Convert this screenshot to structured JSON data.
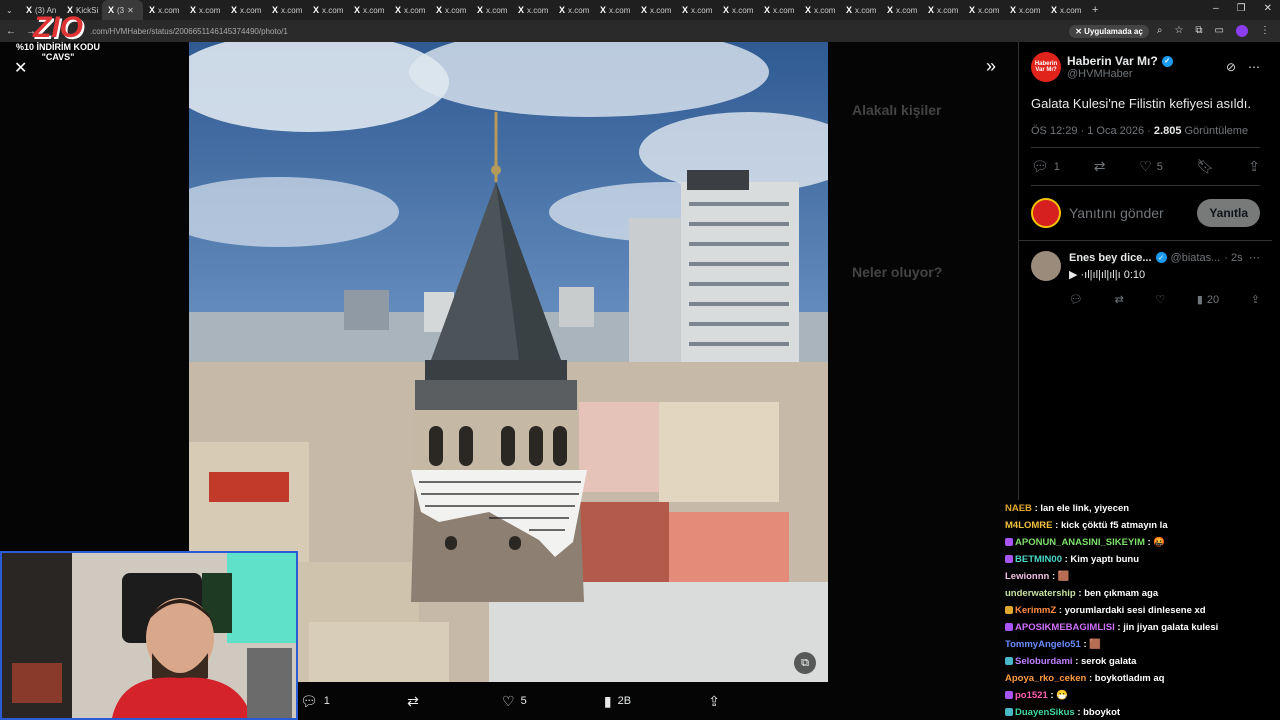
{
  "browser": {
    "tabs": [
      "(3) An",
      "KickSi",
      "(3",
      "x.com",
      "x.com",
      "x.com",
      "x.com",
      "x.com",
      "x.com",
      "x.com",
      "x.com",
      "x.com",
      "x.com",
      "x.com",
      "x.com",
      "x.com",
      "x.com",
      "x.com",
      "x.com",
      "x.com",
      "x.com",
      "x.com",
      "x.com",
      "x.com",
      "x.com",
      "x.com"
    ],
    "new_tab": "+",
    "url": ".com/HVMHaber/status/2006651146145374490/photo/1",
    "app_pill": "Uygulamada aç"
  },
  "overlay_logo": {
    "brand": "ZIO",
    "promo": "%10 İNDİRİM KODU \"CAVS\""
  },
  "viewer": {
    "close_icon": "close-icon",
    "ghost": {
      "related_heading": "Alakalı kişiler",
      "trending_heading": "Neler oluyor?"
    },
    "actions": {
      "replies": "1",
      "reposts": "",
      "likes": "5",
      "views": "2B"
    }
  },
  "tweet": {
    "author_name": "Haberin Var Mı?",
    "author_handle": "@HVMHaber",
    "avatar_text": "Haberin Var Mı?",
    "text": "Galata Kulesi'ne Filistin kefiyesi asıldı.",
    "time": "ÖS 12:29 · 1 Oca 2026 · ",
    "views_count": "2.805",
    "views_label": " Görüntüleme",
    "stats": {
      "replies": "1",
      "likes": "5"
    },
    "reply_placeholder": "Yanıtını gönder",
    "reply_button": "Yanıtla"
  },
  "reply": {
    "author_name": "Enes bey dice...",
    "author_handle": "@biatas...",
    "age": "· 2s",
    "audio": "▶ ·ıl|ıl|ıl|ıl|ı 0:10",
    "views": "20"
  },
  "chat": [
    {
      "user": "NAEB",
      "color": "#e0a82e",
      "badge": "",
      "msg": ": lan ele link, yiyecen"
    },
    {
      "user": "M4LOMRE",
      "color": "#f0c040",
      "badge": "",
      "msg": ": kick çöktü f5 atmayın la"
    },
    {
      "user": "APONUN_ANASINI_SIKEYIM",
      "color": "#7de06a",
      "badge": "p",
      "msg": ": 🤬"
    },
    {
      "user": "BETMIN00",
      "color": "#4ad8c8",
      "badge": "p",
      "msg": ": Kim yaptı bunu"
    },
    {
      "user": "Lewionnn",
      "color": "#f0c0e0",
      "badge": "",
      "msg": ": 🟫"
    },
    {
      "user": "underwatership",
      "color": "#c8e0a0",
      "badge": "",
      "msg": ": ben çıkmam aga"
    },
    {
      "user": "KerimmZ",
      "color": "#ff8c40",
      "badge": "g",
      "msg": ": yorumlardaki sesi dinlesene xd"
    },
    {
      "user": "APOSIKMEBAGIMLISI",
      "color": "#d070ff",
      "badge": "p",
      "msg": ": jin jiyan galata kulesi"
    },
    {
      "user": "TommyAngelo51",
      "color": "#6a8cff",
      "badge": "",
      "msg": ": 🟫"
    },
    {
      "user": "Seloburdami",
      "color": "#c080ff",
      "badge": "c",
      "msg": ": serok galata"
    },
    {
      "user": "Apoya_rko_ceken",
      "color": "#ff9a40",
      "badge": "",
      "msg": ": boykotladım aq"
    },
    {
      "user": "po1521",
      "color": "#ff60b0",
      "badge": "p",
      "msg": ": 😷"
    },
    {
      "user": "DuayenSikus",
      "color": "#40d8a0",
      "badge": "c",
      "msg": ": bboykot"
    }
  ]
}
